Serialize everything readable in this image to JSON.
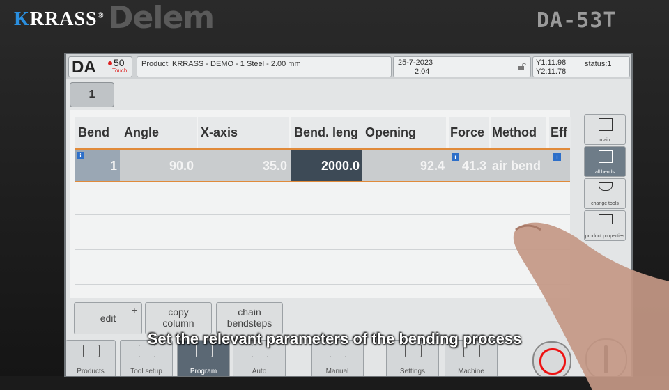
{
  "brand": {
    "krrass": "KRRASS",
    "krrass_first": "K",
    "krrass_rest": "RRASS",
    "reg": "®",
    "delem": "Delem",
    "model": "DA-53T"
  },
  "screen": {
    "logo": {
      "da": "DA",
      "num": "50",
      "touch": "Touch"
    },
    "product": "Product: KRRASS - DEMO - 1 Steel - 2.00 mm",
    "date": "25-7-2023",
    "time": "2:04",
    "y1": "Y1:11.98",
    "y2": "Y2:11.78",
    "status": "status:1",
    "tab": "1"
  },
  "table": {
    "headers": [
      "Bend",
      "Angle",
      "X-axis",
      "Bend. leng",
      "Opening",
      "Force",
      "Method",
      "Eff"
    ],
    "row": {
      "bend": "1",
      "angle": "90.0",
      "x_axis": "35.0",
      "bend_length": "2000.0",
      "opening": "92.4",
      "force": "41.3",
      "method": "air bend"
    },
    "info_badge": "i"
  },
  "side_menu": [
    {
      "label": "main"
    },
    {
      "label": "all bends"
    },
    {
      "label": "change tools"
    },
    {
      "label": "product properties"
    }
  ],
  "actions": {
    "edit": "edit",
    "plus": "+",
    "copy_column": "copy column",
    "chain_bendsteps": "chain bendsteps"
  },
  "bottom_nav": [
    {
      "label": "Products"
    },
    {
      "label": "Tool setup"
    },
    {
      "label": "Program"
    },
    {
      "label": "Auto"
    },
    {
      "label": "Manual"
    },
    {
      "label": "Settings"
    },
    {
      "label": "Machine"
    }
  ],
  "subtitle": "Set the relevant parameters of the bending process",
  "colors": {
    "accent_line": "#e08a3a",
    "selected_cell": "#3d4a56",
    "info_badge": "#2d6fc9",
    "stop_ring": "#e11111"
  }
}
